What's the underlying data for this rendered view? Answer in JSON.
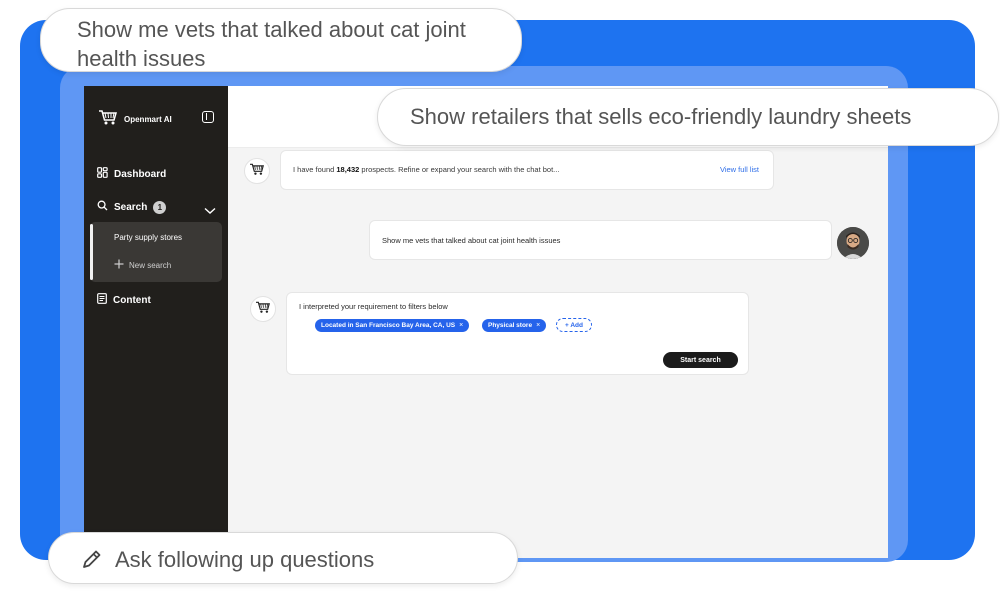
{
  "callouts": {
    "query_1": "Show me vets that talked about cat joint health issues",
    "query_2": "Show retailers that sells eco-friendly laundry sheets",
    "followup": "Ask following up questions"
  },
  "sidebar": {
    "brand": "Openmart AI",
    "items": [
      {
        "label": "Dashboard",
        "icon": "dashboard-icon"
      },
      {
        "label": "Search",
        "icon": "search-icon",
        "badge": "1"
      },
      {
        "label": "Content",
        "icon": "document-icon"
      }
    ],
    "search_sub": {
      "saved": "Party supply stores",
      "new": "New search"
    }
  },
  "chat": {
    "found_prefix": "I have found ",
    "found_count": "18,432",
    "found_suffix": " prospects. Refine or expand your search with the chat bot...",
    "view_full_list": "View full list",
    "user_message": "Show me vets that talked about cat joint health issues",
    "interpretation": "I interpreted your requirement to filters below",
    "filters": [
      "Located in San Francisco Bay Area, CA, US",
      "Physical store"
    ],
    "add_label": "+ Add",
    "start_search": "Start search"
  },
  "colors": {
    "brand_blue": "#1e73f0",
    "light_blue": "#5f97f4",
    "sidebar": "#211f1c",
    "chip": "#2563eb"
  }
}
